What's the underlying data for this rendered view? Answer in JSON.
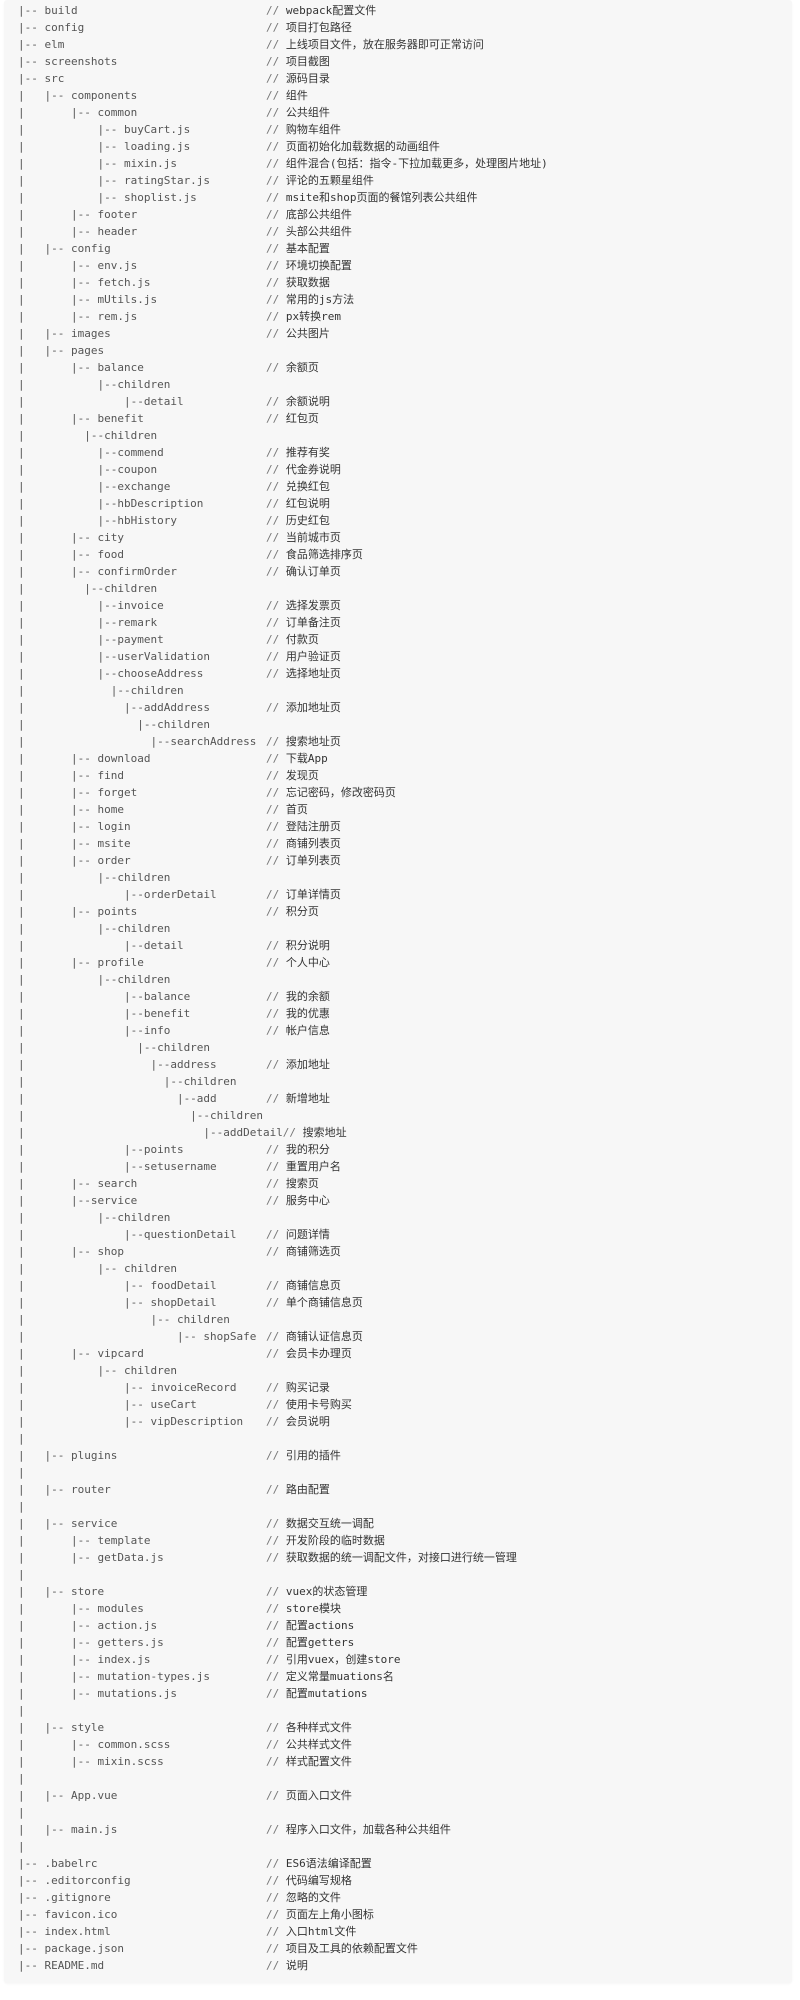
{
  "code_block": {
    "lines": [
      {
        "tree": "|-- build",
        "comment": "webpack配置文件"
      },
      {
        "tree": "|-- config",
        "comment": "项目打包路径"
      },
      {
        "tree": "|-- elm",
        "comment": "上线项目文件，放在服务器即可正常访问"
      },
      {
        "tree": "|-- screenshots",
        "comment": "项目截图"
      },
      {
        "tree": "|-- src",
        "comment": "源码目录"
      },
      {
        "tree": "|   |-- components",
        "comment": "组件"
      },
      {
        "tree": "|       |-- common",
        "comment": "公共组件"
      },
      {
        "tree": "|           |-- buyCart.js",
        "comment": "购物车组件"
      },
      {
        "tree": "|           |-- loading.js",
        "comment": "页面初始化加载数据的动画组件"
      },
      {
        "tree": "|           |-- mixin.js",
        "comment": "组件混合(包括：指令-下拉加载更多，处理图片地址)"
      },
      {
        "tree": "|           |-- ratingStar.js",
        "comment": "评论的五颗星组件"
      },
      {
        "tree": "|           |-- shoplist.js",
        "comment": "msite和shop页面的餐馆列表公共组件"
      },
      {
        "tree": "|       |-- footer",
        "comment": "底部公共组件"
      },
      {
        "tree": "|       |-- header",
        "comment": "头部公共组件"
      },
      {
        "tree": "|   |-- config",
        "comment": "基本配置"
      },
      {
        "tree": "|       |-- env.js",
        "comment": "环境切换配置"
      },
      {
        "tree": "|       |-- fetch.js",
        "comment": "获取数据"
      },
      {
        "tree": "|       |-- mUtils.js",
        "comment": "常用的js方法"
      },
      {
        "tree": "|       |-- rem.js",
        "comment": "px转换rem"
      },
      {
        "tree": "|   |-- images",
        "comment": "公共图片"
      },
      {
        "tree": "|   |-- pages",
        "comment": ""
      },
      {
        "tree": "|       |-- balance",
        "comment": "余额页"
      },
      {
        "tree": "|           |--children",
        "comment": ""
      },
      {
        "tree": "|               |--detail",
        "comment": "余额说明"
      },
      {
        "tree": "|       |-- benefit",
        "comment": "红包页"
      },
      {
        "tree": "|         |--children",
        "comment": ""
      },
      {
        "tree": "|           |--commend",
        "comment": "推荐有奖"
      },
      {
        "tree": "|           |--coupon",
        "comment": "代金券说明"
      },
      {
        "tree": "|           |--exchange",
        "comment": "兑换红包"
      },
      {
        "tree": "|           |--hbDescription",
        "comment": "红包说明"
      },
      {
        "tree": "|           |--hbHistory",
        "comment": "历史红包"
      },
      {
        "tree": "|       |-- city",
        "comment": "当前城市页"
      },
      {
        "tree": "|       |-- food",
        "comment": "食品筛选排序页"
      },
      {
        "tree": "|       |-- confirmOrder",
        "comment": "确认订单页"
      },
      {
        "tree": "|         |--children",
        "comment": ""
      },
      {
        "tree": "|           |--invoice",
        "comment": "选择发票页"
      },
      {
        "tree": "|           |--remark",
        "comment": "订单备注页"
      },
      {
        "tree": "|           |--payment",
        "comment": "付款页"
      },
      {
        "tree": "|           |--userValidation",
        "comment": "用户验证页"
      },
      {
        "tree": "|           |--chooseAddress",
        "comment": "选择地址页"
      },
      {
        "tree": "|             |--children",
        "comment": ""
      },
      {
        "tree": "|               |--addAddress",
        "comment": "添加地址页"
      },
      {
        "tree": "|                 |--children",
        "comment": ""
      },
      {
        "tree": "|                   |--searchAddress",
        "comment": "搜索地址页"
      },
      {
        "tree": "|       |-- download",
        "comment": "下载App"
      },
      {
        "tree": "|       |-- find",
        "comment": "发现页"
      },
      {
        "tree": "|       |-- forget",
        "comment": "忘记密码，修改密码页"
      },
      {
        "tree": "|       |-- home",
        "comment": "首页"
      },
      {
        "tree": "|       |-- login",
        "comment": "登陆注册页"
      },
      {
        "tree": "|       |-- msite",
        "comment": "商铺列表页"
      },
      {
        "tree": "|       |-- order",
        "comment": "订单列表页"
      },
      {
        "tree": "|           |--children",
        "comment": ""
      },
      {
        "tree": "|               |--orderDetail",
        "comment": "订单详情页"
      },
      {
        "tree": "|       |-- points",
        "comment": "积分页"
      },
      {
        "tree": "|           |--children",
        "comment": ""
      },
      {
        "tree": "|               |--detail",
        "comment": "积分说明"
      },
      {
        "tree": "|       |-- profile",
        "comment": "个人中心"
      },
      {
        "tree": "|           |--children",
        "comment": ""
      },
      {
        "tree": "|               |--balance",
        "comment": "我的余额"
      },
      {
        "tree": "|               |--benefit",
        "comment": "我的优惠"
      },
      {
        "tree": "|               |--info",
        "comment": "帐户信息"
      },
      {
        "tree": "|                 |--children",
        "comment": ""
      },
      {
        "tree": "|                   |--address",
        "comment": "添加地址"
      },
      {
        "tree": "|                     |--children",
        "comment": ""
      },
      {
        "tree": "|                       |--add",
        "comment": "新增地址"
      },
      {
        "tree": "|                         |--children",
        "comment": ""
      },
      {
        "tree": "|                           |--addDetail",
        "comment": "搜索地址",
        "inline": true
      },
      {
        "tree": "|               |--points",
        "comment": "我的积分"
      },
      {
        "tree": "|               |--setusername",
        "comment": "重置用户名"
      },
      {
        "tree": "|       |-- search",
        "comment": "搜索页"
      },
      {
        "tree": "|       |--service",
        "comment": "服务中心"
      },
      {
        "tree": "|           |--children",
        "comment": ""
      },
      {
        "tree": "|               |--questionDetail",
        "comment": "问题详情"
      },
      {
        "tree": "|       |-- shop",
        "comment": "商铺筛选页"
      },
      {
        "tree": "|           |-- children",
        "comment": ""
      },
      {
        "tree": "|               |-- foodDetail",
        "comment": "商铺信息页"
      },
      {
        "tree": "|               |-- shopDetail",
        "comment": "单个商铺信息页"
      },
      {
        "tree": "|                   |-- children",
        "comment": ""
      },
      {
        "tree": "|                       |-- shopSafe",
        "comment": "商铺认证信息页"
      },
      {
        "tree": "|       |-- vipcard",
        "comment": "会员卡办理页"
      },
      {
        "tree": "|           |-- children",
        "comment": ""
      },
      {
        "tree": "|               |-- invoiceRecord",
        "comment": "购买记录"
      },
      {
        "tree": "|               |-- useCart",
        "comment": "使用卡号购买"
      },
      {
        "tree": "|               |-- vipDescription",
        "comment": "会员说明"
      },
      {
        "tree": "|",
        "comment": ""
      },
      {
        "tree": "|   |-- plugins",
        "comment": "引用的插件"
      },
      {
        "tree": "|",
        "comment": ""
      },
      {
        "tree": "|   |-- router",
        "comment": "路由配置"
      },
      {
        "tree": "|",
        "comment": ""
      },
      {
        "tree": "|   |-- service",
        "comment": "数据交互统一调配"
      },
      {
        "tree": "|       |-- template",
        "comment": "开发阶段的临时数据"
      },
      {
        "tree": "|       |-- getData.js",
        "comment": "获取数据的统一调配文件，对接口进行统一管理"
      },
      {
        "tree": "|",
        "comment": ""
      },
      {
        "tree": "|   |-- store",
        "comment": "vuex的状态管理"
      },
      {
        "tree": "|       |-- modules",
        "comment": "store模块"
      },
      {
        "tree": "|       |-- action.js",
        "comment": "配置actions"
      },
      {
        "tree": "|       |-- getters.js",
        "comment": "配置getters"
      },
      {
        "tree": "|       |-- index.js",
        "comment": "引用vuex，创建store"
      },
      {
        "tree": "|       |-- mutation-types.js",
        "comment": "定义常量muations名"
      },
      {
        "tree": "|       |-- mutations.js",
        "comment": "配置mutations"
      },
      {
        "tree": "|",
        "comment": ""
      },
      {
        "tree": "|   |-- style",
        "comment": "各种样式文件"
      },
      {
        "tree": "|       |-- common.scss",
        "comment": "公共样式文件"
      },
      {
        "tree": "|       |-- mixin.scss",
        "comment": "样式配置文件"
      },
      {
        "tree": "|",
        "comment": ""
      },
      {
        "tree": "|   |-- App.vue",
        "comment": "页面入口文件"
      },
      {
        "tree": "|",
        "comment": ""
      },
      {
        "tree": "|   |-- main.js",
        "comment": "程序入口文件，加载各种公共组件"
      },
      {
        "tree": "|",
        "comment": ""
      },
      {
        "tree": "|-- .babelrc",
        "comment": "ES6语法编译配置"
      },
      {
        "tree": "|-- .editorconfig",
        "comment": "代码编写规格"
      },
      {
        "tree": "|-- .gitignore",
        "comment": "忽略的文件"
      },
      {
        "tree": "|-- favicon.ico",
        "comment": "页面左上角小图标"
      },
      {
        "tree": "|-- index.html",
        "comment": "入口html文件"
      },
      {
        "tree": "|-- package.json",
        "comment": "项目及工具的依赖配置文件"
      },
      {
        "tree": "|-- README.md",
        "comment": "说明"
      }
    ],
    "comment_prefix": "//"
  }
}
